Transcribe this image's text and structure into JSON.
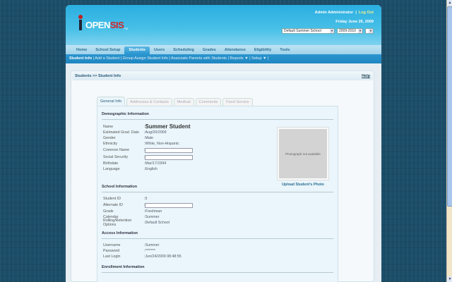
{
  "header": {
    "user": "Admin Administrator",
    "logout": "Log Out",
    "date": "Friday June 26, 2009",
    "school": "Default Summer School",
    "year": "2009-2010",
    "extra": "",
    "logo": "OPENSIS"
  },
  "nav": [
    "Home",
    "School Setup",
    "Students",
    "Users",
    "Scheduling",
    "Grades",
    "Attendance",
    "Eligibility",
    "Tools"
  ],
  "subnav": {
    "items": [
      "Student Info",
      "Add a Student",
      "Group Assign Student Info",
      "Associate Parents with Students",
      "Reports ▼",
      "Setup ▼"
    ]
  },
  "breadcrumb": "Students >> Student Info",
  "help": "Help",
  "tabs": [
    "General Info",
    "Addresses & Contacts",
    "Medical",
    "Comments",
    "Food Service"
  ],
  "demographic": {
    "title": "Demographic Information",
    "rows": [
      {
        "label": "Name",
        "value": "Summer Student"
      },
      {
        "label": "Estimated Grad. Date",
        "value": "Aug/20/2009"
      },
      {
        "label": "Gender",
        "value": "Male"
      },
      {
        "label": "Ethnicity",
        "value": "White, Non-Hispanic"
      },
      {
        "label": "Common Name",
        "value": ""
      },
      {
        "label": "Social Security",
        "value": ""
      },
      {
        "label": "Birthdate",
        "value": "Mar/17/1994"
      },
      {
        "label": "Language",
        "value": "English"
      }
    ]
  },
  "photo": {
    "placeholder": "Photograph not available",
    "upload": "Upload Student's Photo"
  },
  "school": {
    "title": "School Information",
    "rows": [
      {
        "label": "Student ID",
        "value": "5"
      },
      {
        "label": "Alternate ID",
        "value": ""
      },
      {
        "label": "Grade",
        "value": "Freshman"
      },
      {
        "label": "Calendar",
        "value": "Summer"
      },
      {
        "label": "Rolling/Retention Options",
        "value": "Default School"
      }
    ]
  },
  "access": {
    "title": "Access Information",
    "rows": [
      {
        "label": "Username",
        "value": "Summer"
      },
      {
        "label": "Password",
        "value": "*******"
      },
      {
        "label": "Last Login",
        "value": "Jun/24/2009 08:48:55"
      }
    ]
  },
  "enrollment": {
    "title": "Enrollment Information"
  }
}
